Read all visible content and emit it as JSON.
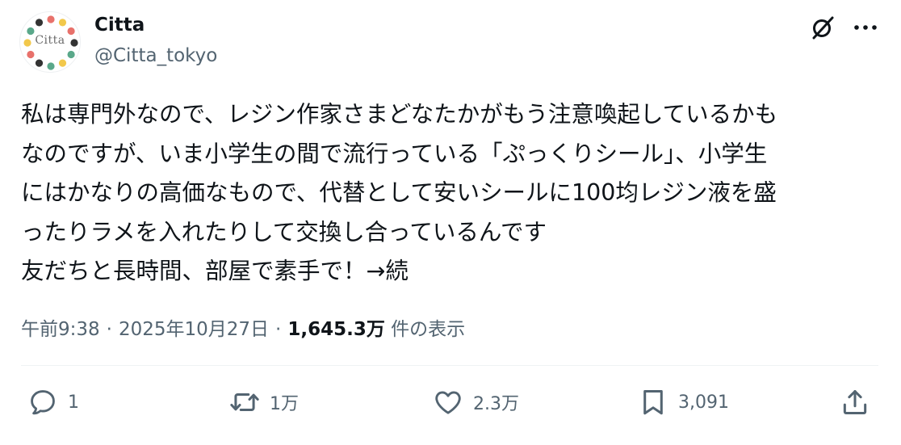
{
  "author": {
    "display_name": "Citta",
    "handle": "@Citta_tokyo",
    "avatar_text": "Citta"
  },
  "header_icons": {
    "grok": "grok-icon",
    "more": "more-icon"
  },
  "tweet": {
    "lines": [
      "私は専門外なので、レジン作家さまどなたかがもう注意喚起しているかも",
      "なのですが、いま小学生の間で流行っている「ぷっくりシール」、小学生",
      "にはかなりの高価なもので、代替として安いシールに100均レジン液を盛",
      "ったりラメを入れたりして交換し合っているんです",
      "友だちと長時間、部屋で素手で！→続"
    ]
  },
  "meta": {
    "time": "午前9:38",
    "separator1": "·",
    "date": "2025年10月27日",
    "separator2": "·",
    "views_count": "1,645.3万",
    "views_label": "件の表示"
  },
  "actions": {
    "reply_count": "1",
    "repost_count": "1万",
    "like_count": "2.3万",
    "bookmark_count": "3,091"
  },
  "colors": {
    "text_primary": "#0f1419",
    "text_secondary": "#536471",
    "divider": "#eff3f4",
    "avatar_dots": [
      "#e8716b",
      "#f2c84b",
      "#5aa88a",
      "#333333"
    ]
  }
}
